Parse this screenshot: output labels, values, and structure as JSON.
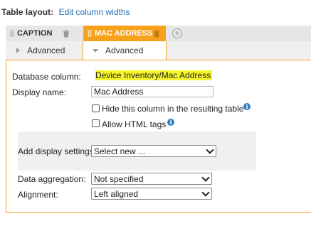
{
  "header": {
    "label": "Table layout:",
    "link": "Edit column widths"
  },
  "tabs": [
    {
      "name": "CAPTION",
      "active": false
    },
    {
      "name": "MAC ADDRESS",
      "active": true
    }
  ],
  "subtabs": {
    "caption": "Advanced",
    "mac": "Advanced"
  },
  "form": {
    "database_column_label": "Database column:",
    "database_column_value": "Device Inventory/Mac Address",
    "display_name_label": "Display name:",
    "display_name_value": "Mac Address",
    "hide_column_label": "Hide this column in the resulting table",
    "allow_html_label": "Allow HTML tags",
    "add_display_settings_label": "Add display settings:",
    "add_display_settings_value": "Select new ...",
    "data_aggregation_label": "Data aggregation:",
    "data_aggregation_value": "Not specified",
    "alignment_label": "Alignment:",
    "alignment_value": "Left aligned"
  },
  "colors": {
    "accent": "#f7a21c",
    "highlight": "#f6f42a",
    "link": "#1f6fb2",
    "info": "#2d7ec4"
  }
}
